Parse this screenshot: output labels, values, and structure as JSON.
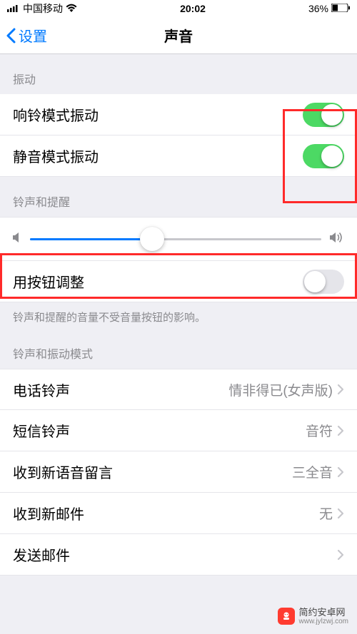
{
  "status_bar": {
    "carrier": "中国移动",
    "time": "20:02",
    "battery": "36%"
  },
  "nav": {
    "back": "设置",
    "title": "声音"
  },
  "sections": {
    "vibration": {
      "header": "振动",
      "ring_label": "响铃模式振动",
      "silent_label": "静音模式振动"
    },
    "ringer": {
      "header": "铃声和提醒",
      "slider_percent": 42,
      "button_label": "用按钮调整",
      "footer": "铃声和提醒的音量不受音量按钮的影响。"
    },
    "patterns": {
      "header": "铃声和振动模式",
      "rows": [
        {
          "label": "电话铃声",
          "value": "情非得已(女声版)"
        },
        {
          "label": "短信铃声",
          "value": "音符"
        },
        {
          "label": "收到新语音留言",
          "value": "三全音"
        },
        {
          "label": "收到新邮件",
          "value": "无"
        },
        {
          "label": "发送邮件",
          "value": ""
        }
      ]
    }
  },
  "watermark": {
    "name": "简约安卓网",
    "url": "www.jylzwj.com"
  }
}
